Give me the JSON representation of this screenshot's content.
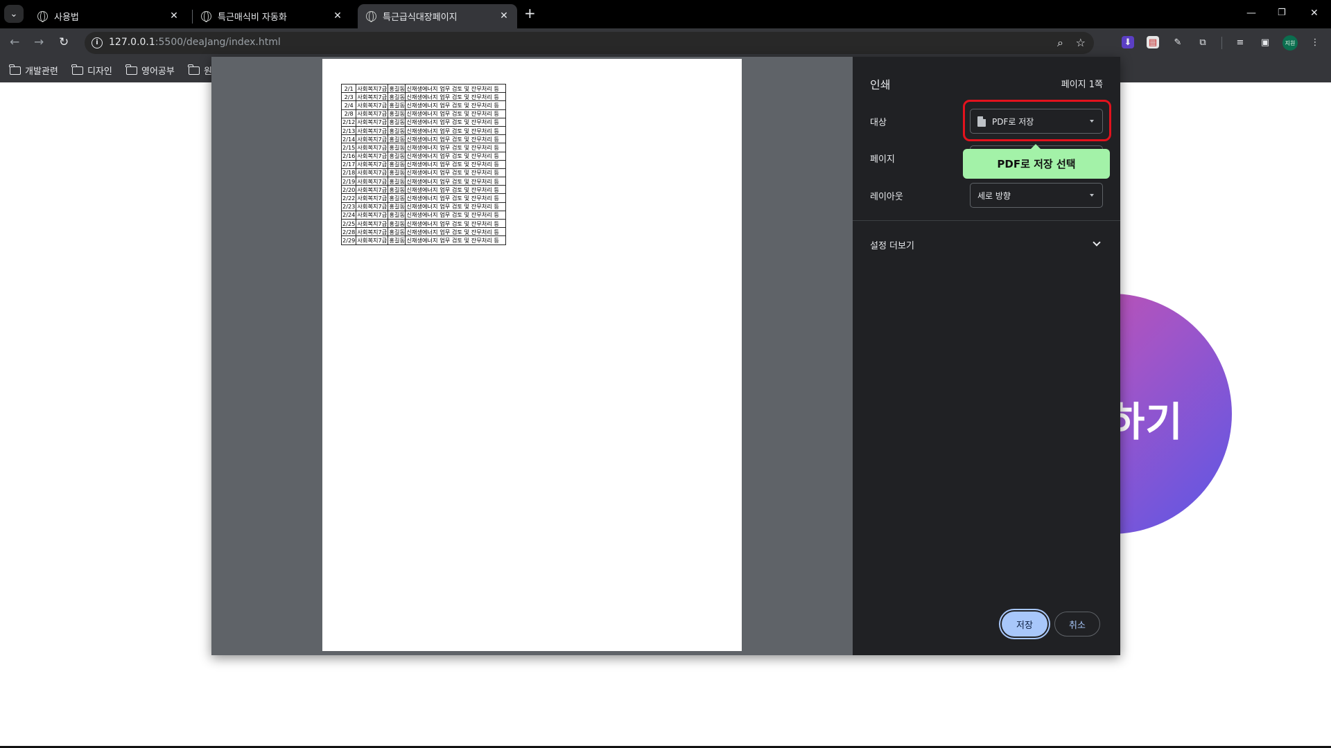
{
  "browser": {
    "tabs": [
      {
        "title": "사용법",
        "active": false
      },
      {
        "title": "특근매식비 자동화",
        "active": false
      },
      {
        "title": "특근급식대장페이지",
        "active": true
      }
    ],
    "url_host": "127.0.0.1",
    "url_path": ":5500/deaJang/index.html",
    "bookmarks": [
      "개발관련",
      "디자인",
      "영어공부",
      "원"
    ],
    "profile_label": "지원"
  },
  "page": {
    "circle_text": "하기",
    "circle_gradient": [
      "#d14ea4",
      "#a055c8",
      "#5b56e6"
    ]
  },
  "print_dialog": {
    "title": "인쇄",
    "page_count": "페이지 1쪽",
    "destination_label": "대상",
    "destination_value": "PDF로 저장",
    "pages_label": "페이지",
    "layout_label": "레이아웃",
    "layout_value": "세로 방향",
    "more_settings": "설정 더보기",
    "save_button": "저장",
    "cancel_button": "취소",
    "annotation_tooltip": "PDF로 저장 선택",
    "highlight_color": "#e3121d",
    "accent_color": "#a8c7fa"
  },
  "preview_table": {
    "rows": [
      [
        "2/1",
        "사회복지7급",
        "홍길동",
        "신재생에너지 업무 검토 및 잔무처리 등"
      ],
      [
        "2/3",
        "사회복지7급",
        "홍길동",
        "신재생에너지 업무 검토 및 잔무처리 등"
      ],
      [
        "2/4",
        "사회복지7급",
        "홍길동",
        "신재생에너지 업무 검토 및 잔무처리 등"
      ],
      [
        "2/8",
        "사회복지7급",
        "홍길동",
        "신재생에너지 업무 검토 및 잔무처리 등"
      ],
      [
        "2/12",
        "사회복지7급",
        "홍길동",
        "신재생에너지 업무 검토 및 잔무처리 등"
      ],
      [
        "2/13",
        "사회복지7급",
        "홍길동",
        "신재생에너지 업무 검토 및 잔무처리 등"
      ],
      [
        "2/14",
        "사회복지7급",
        "홍길동",
        "신재생에너지 업무 검토 및 잔무처리 등"
      ],
      [
        "2/15",
        "사회복지7급",
        "홍길동",
        "신재생에너지 업무 검토 및 잔무처리 등"
      ],
      [
        "2/16",
        "사회복지7급",
        "홍길동",
        "신재생에너지 업무 검토 및 잔무처리 등"
      ],
      [
        "2/17",
        "사회복지7급",
        "홍길동",
        "신재생에너지 업무 검토 및 잔무처리 등"
      ],
      [
        "2/18",
        "사회복지7급",
        "홍길동",
        "신재생에너지 업무 검토 및 잔무처리 등"
      ],
      [
        "2/19",
        "사회복지7급",
        "홍길동",
        "신재생에너지 업무 검토 및 잔무처리 등"
      ],
      [
        "2/20",
        "사회복지7급",
        "홍길동",
        "신재생에너지 업무 검토 및 잔무처리 등"
      ],
      [
        "2/22",
        "사회복지7급",
        "홍길동",
        "신재생에너지 업무 검토 및 잔무처리 등"
      ],
      [
        "2/23",
        "사회복지7급",
        "홍길동",
        "신재생에너지 업무 검토 및 잔무처리 등"
      ],
      [
        "2/24",
        "사회복지7급",
        "홍길동",
        "신재생에너지 업무 검토 및 잔무처리 등"
      ],
      [
        "2/25",
        "사회복지7급",
        "홍길동",
        "신재생에너지 업무 검토 및 잔무처리 등"
      ],
      [
        "2/28",
        "사회복지7급",
        "홍길동",
        "신재생에너지 업무 검토 및 잔무처리 등"
      ],
      [
        "2/29",
        "사회복지7급",
        "홍길동",
        "신재생에너지 업무 검토 및 잔무처리 등"
      ]
    ]
  }
}
